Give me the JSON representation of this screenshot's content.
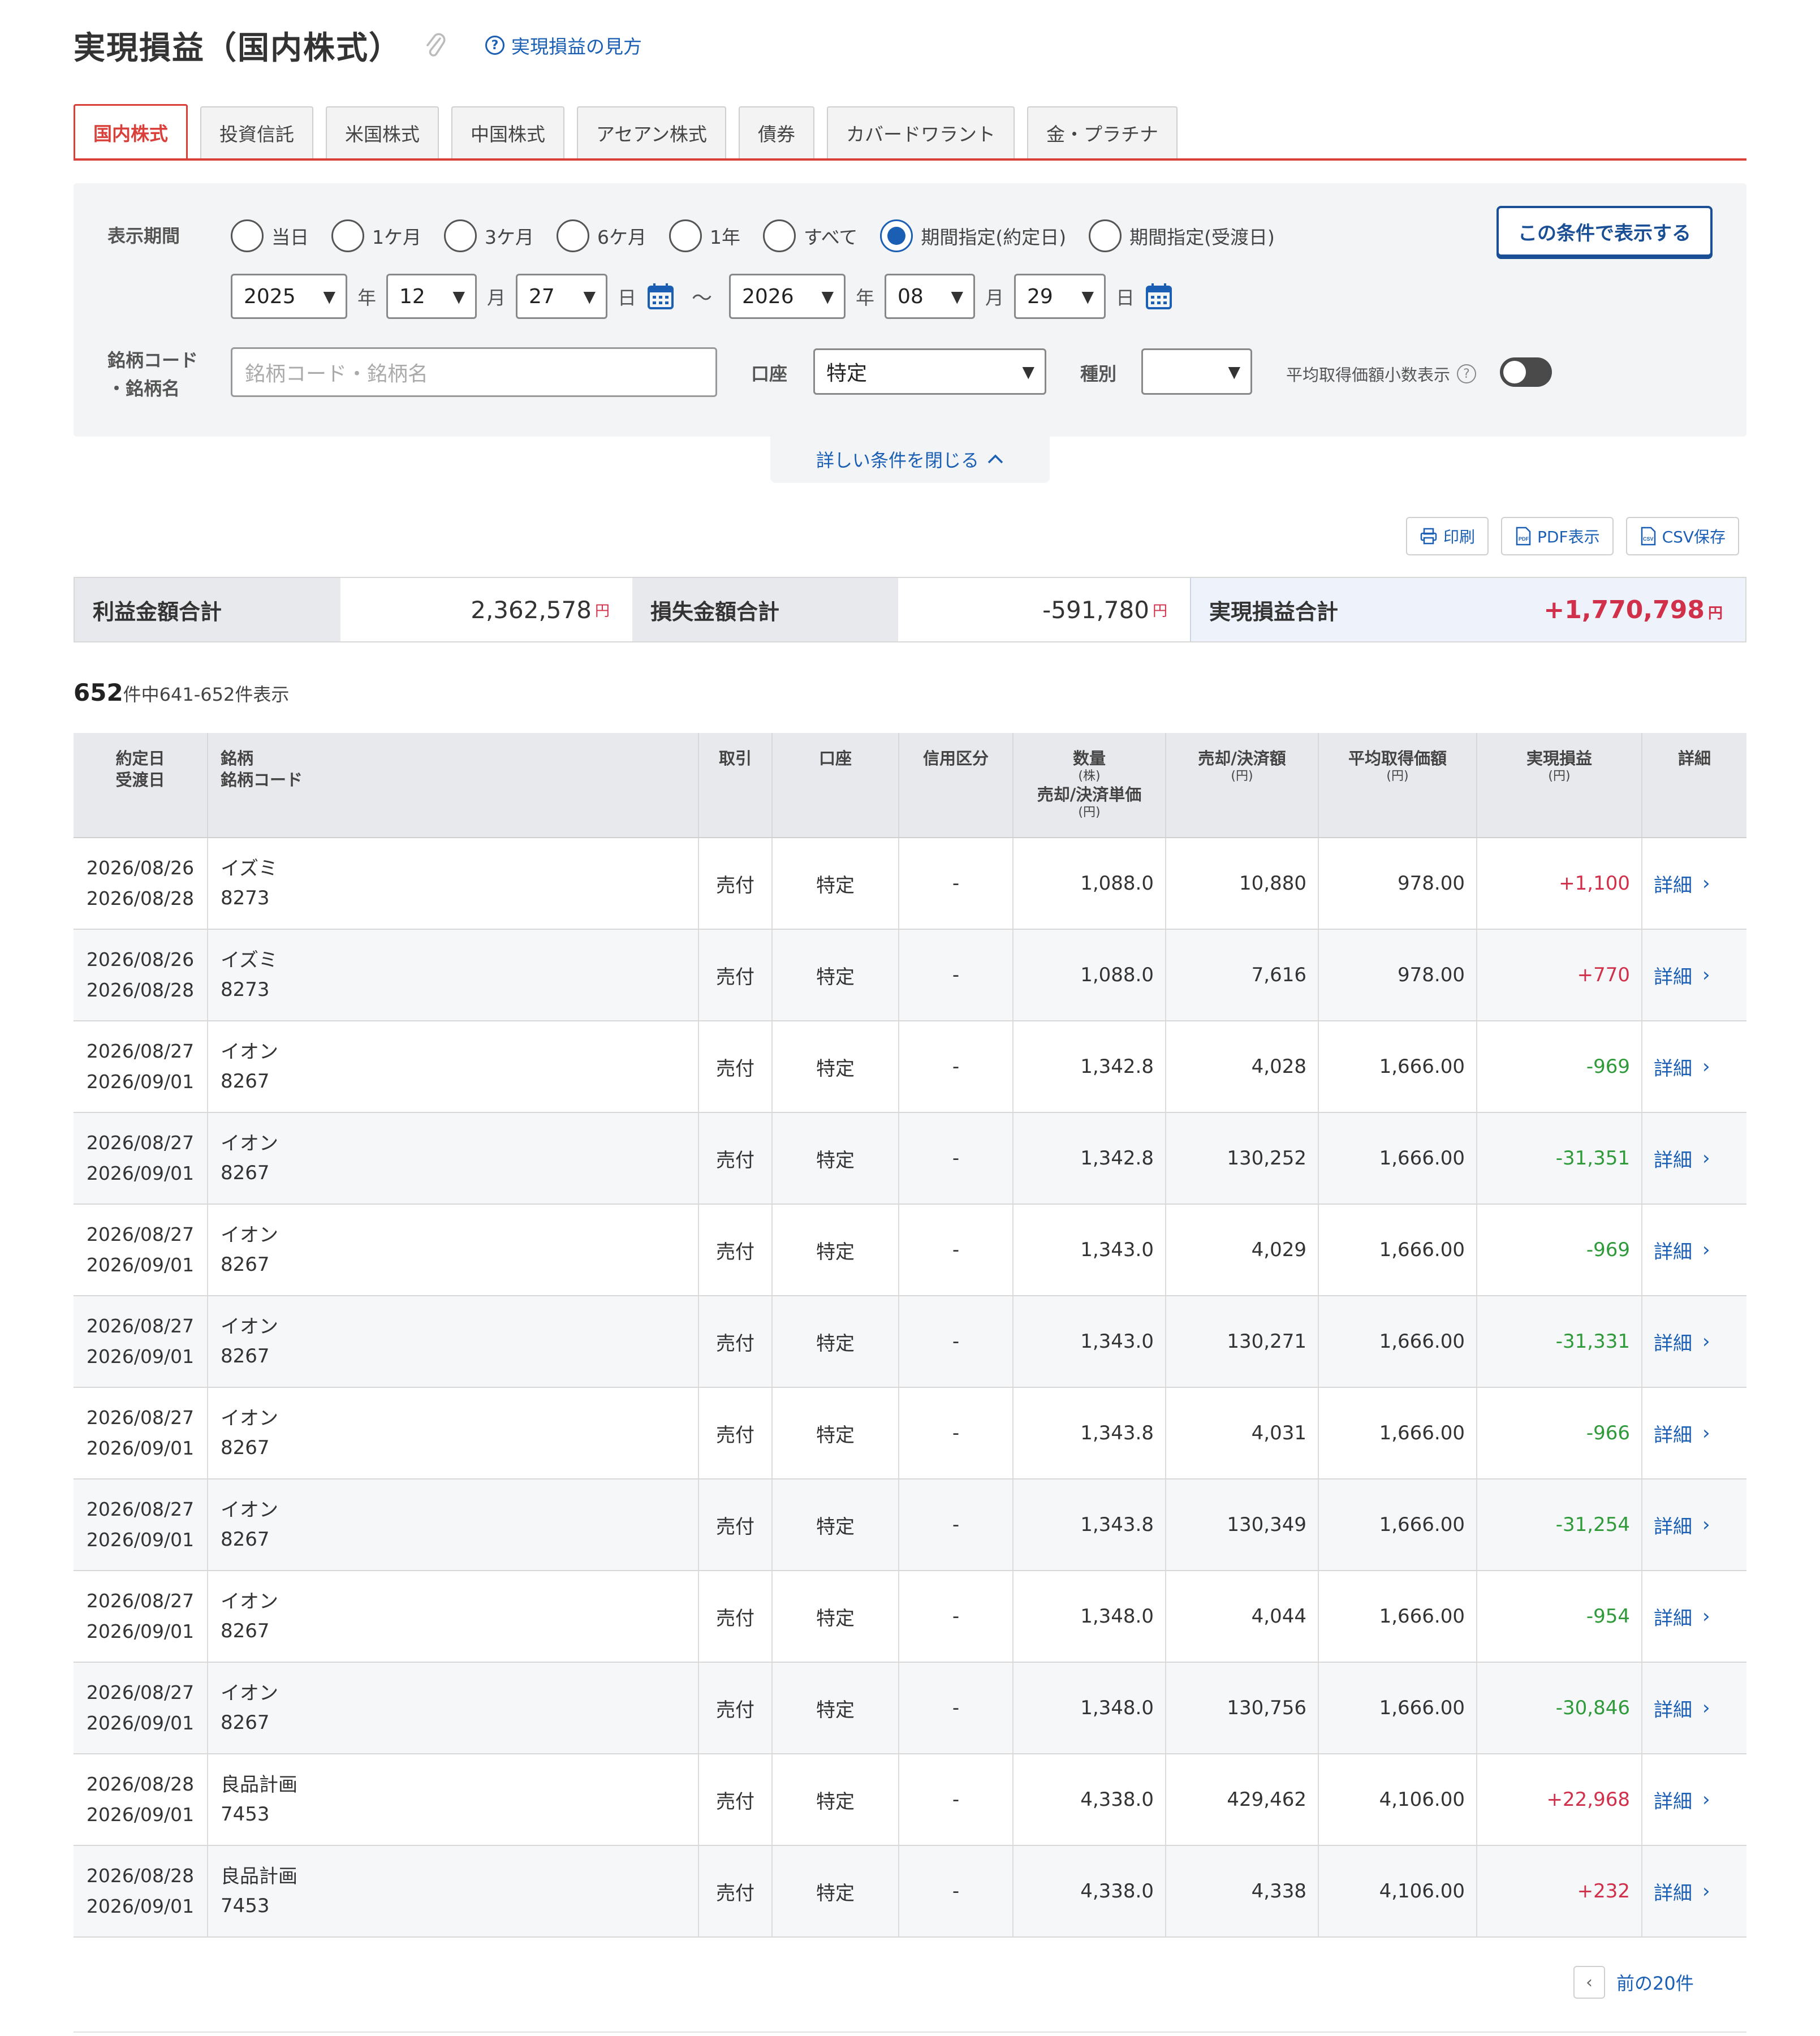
{
  "header": {
    "title": "実現損益（国内株式）",
    "help_link": "実現損益の見方"
  },
  "tabs": [
    "国内株式",
    "投資信託",
    "米国株式",
    "中国株式",
    "アセアン株式",
    "債券",
    "カバードワラント",
    "金・プラチナ"
  ],
  "filter": {
    "period_label": "表示期間",
    "period_options": [
      "当日",
      "1ケ月",
      "3ケ月",
      "6ケ月",
      "1年",
      "すべて",
      "期間指定(約定日)",
      "期間指定(受渡日)"
    ],
    "period_selected": "期間指定(約定日)",
    "show_button": "この条件で表示する",
    "from": {
      "year": "2025",
      "month": "12",
      "day": "27"
    },
    "to": {
      "year": "2026",
      "month": "08",
      "day": "29"
    },
    "unit_year": "年",
    "unit_month": "月",
    "unit_day": "日",
    "tilde": "～",
    "code_label_1": "銘柄コード",
    "code_label_2": "・銘柄名",
    "code_placeholder": "銘柄コード・銘柄名",
    "account_label": "口座",
    "account_value": "特定",
    "kind_label": "種別",
    "kind_value": "",
    "decimal_label": "平均取得価額小数表示",
    "decimal_toggle": "off",
    "close_link": "詳しい条件を閉じる"
  },
  "actions": {
    "print": "印刷",
    "pdf": "PDF表示",
    "csv": "CSV保存"
  },
  "summary": {
    "profit_label": "利益金額合計",
    "profit_value": "2,362,578",
    "loss_label": "損失金額合計",
    "loss_value": "-591,780",
    "total_label": "実現損益合計",
    "total_value": "+1,770,798",
    "yen": "円"
  },
  "count": {
    "total": "652",
    "text": "件中641-652件表示"
  },
  "table": {
    "headers": {
      "date_1": "約定日",
      "date_2": "受渡日",
      "name_1": "銘柄",
      "name_2": "銘柄コード",
      "trade": "取引",
      "account": "口座",
      "margin": "信用区分",
      "qty_1": "数量",
      "qty_unit": "(株)",
      "qty_2": "売却/決済単価",
      "qty_unit2": "(円)",
      "amount": "売却/決済額",
      "amount_unit": "(円)",
      "avg": "平均取得価額",
      "avg_unit": "(円)",
      "pl": "実現損益",
      "pl_unit": "(円)",
      "detail": "詳細"
    },
    "rows": [
      {
        "trade_date": "2026/08/26",
        "settle_date": "2026/08/28",
        "name": "イズミ",
        "code": "8273",
        "trade": "売付",
        "account": "特定",
        "margin": "-",
        "price": "1,088.0",
        "amount": "10,880",
        "avg": "978.00",
        "pl": "+1,100",
        "detail": "詳細"
      },
      {
        "trade_date": "2026/08/26",
        "settle_date": "2026/08/28",
        "name": "イズミ",
        "code": "8273",
        "trade": "売付",
        "account": "特定",
        "margin": "-",
        "price": "1,088.0",
        "amount": "7,616",
        "avg": "978.00",
        "pl": "+770",
        "detail": "詳細"
      },
      {
        "trade_date": "2026/08/27",
        "settle_date": "2026/09/01",
        "name": "イオン",
        "code": "8267",
        "trade": "売付",
        "account": "特定",
        "margin": "-",
        "price": "1,342.8",
        "amount": "4,028",
        "avg": "1,666.00",
        "pl": "-969",
        "detail": "詳細"
      },
      {
        "trade_date": "2026/08/27",
        "settle_date": "2026/09/01",
        "name": "イオン",
        "code": "8267",
        "trade": "売付",
        "account": "特定",
        "margin": "-",
        "price": "1,342.8",
        "amount": "130,252",
        "avg": "1,666.00",
        "pl": "-31,351",
        "detail": "詳細"
      },
      {
        "trade_date": "2026/08/27",
        "settle_date": "2026/09/01",
        "name": "イオン",
        "code": "8267",
        "trade": "売付",
        "account": "特定",
        "margin": "-",
        "price": "1,343.0",
        "amount": "4,029",
        "avg": "1,666.00",
        "pl": "-969",
        "detail": "詳細"
      },
      {
        "trade_date": "2026/08/27",
        "settle_date": "2026/09/01",
        "name": "イオン",
        "code": "8267",
        "trade": "売付",
        "account": "特定",
        "margin": "-",
        "price": "1,343.0",
        "amount": "130,271",
        "avg": "1,666.00",
        "pl": "-31,331",
        "detail": "詳細"
      },
      {
        "trade_date": "2026/08/27",
        "settle_date": "2026/09/01",
        "name": "イオン",
        "code": "8267",
        "trade": "売付",
        "account": "特定",
        "margin": "-",
        "price": "1,343.8",
        "amount": "4,031",
        "avg": "1,666.00",
        "pl": "-966",
        "detail": "詳細"
      },
      {
        "trade_date": "2026/08/27",
        "settle_date": "2026/09/01",
        "name": "イオン",
        "code": "8267",
        "trade": "売付",
        "account": "特定",
        "margin": "-",
        "price": "1,343.8",
        "amount": "130,349",
        "avg": "1,666.00",
        "pl": "-31,254",
        "detail": "詳細"
      },
      {
        "trade_date": "2026/08/27",
        "settle_date": "2026/09/01",
        "name": "イオン",
        "code": "8267",
        "trade": "売付",
        "account": "特定",
        "margin": "-",
        "price": "1,348.0",
        "amount": "4,044",
        "avg": "1,666.00",
        "pl": "-954",
        "detail": "詳細"
      },
      {
        "trade_date": "2026/08/27",
        "settle_date": "2026/09/01",
        "name": "イオン",
        "code": "8267",
        "trade": "売付",
        "account": "特定",
        "margin": "-",
        "price": "1,348.0",
        "amount": "130,756",
        "avg": "1,666.00",
        "pl": "-30,846",
        "detail": "詳細"
      },
      {
        "trade_date": "2026/08/28",
        "settle_date": "2026/09/01",
        "name": "良品計画",
        "code": "7453",
        "trade": "売付",
        "account": "特定",
        "margin": "-",
        "price": "4,338.0",
        "amount": "429,462",
        "avg": "4,106.00",
        "pl": "+22,968",
        "detail": "詳細"
      },
      {
        "trade_date": "2026/08/28",
        "settle_date": "2026/09/01",
        "name": "良品計画",
        "code": "7453",
        "trade": "売付",
        "account": "特定",
        "margin": "-",
        "price": "4,338.0",
        "amount": "4,338",
        "avg": "4,106.00",
        "pl": "+232",
        "detail": "詳細"
      }
    ]
  },
  "pager": {
    "prev": "前の20件"
  },
  "colors": {
    "accent_red": "#d9403a",
    "link_blue": "#1a5fb4",
    "profit": "#d0304a",
    "loss": "#2f9a3a"
  }
}
